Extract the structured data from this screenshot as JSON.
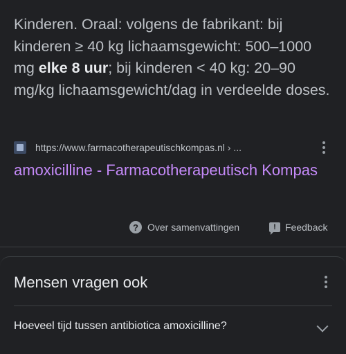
{
  "snippet": {
    "text_before": "Kinderen. Oraal: volgens de fabrikant: bij kinderen ≥ 40 kg lichaamsgewicht: 500–1000 mg ",
    "text_bold": "elke 8 uur",
    "text_after": "; bij kinderen < 40 kg: 20–90 mg/kg lichaamsgewicht/dag in verdeelde doses."
  },
  "source": {
    "url": "https://www.farmacotherapeutischkompas.nl › ...",
    "favicon_icon": "site-favicon"
  },
  "result": {
    "title": "amoxicilline - Farmacotherapeutisch Kompas"
  },
  "feedback_row": {
    "about_label": "Over samenvattingen",
    "feedback_label": "Feedback",
    "about_icon": "question-circle-icon",
    "feedback_icon": "feedback-icon"
  },
  "people_also_ask": {
    "title": "Mensen vragen ook",
    "questions": [
      "Hoeveel tijd tussen antibiotica amoxicilline?"
    ]
  },
  "colors": {
    "background": "#202124",
    "link": "#c58af9",
    "text": "#e8eaed",
    "muted": "#bdc1c6"
  }
}
